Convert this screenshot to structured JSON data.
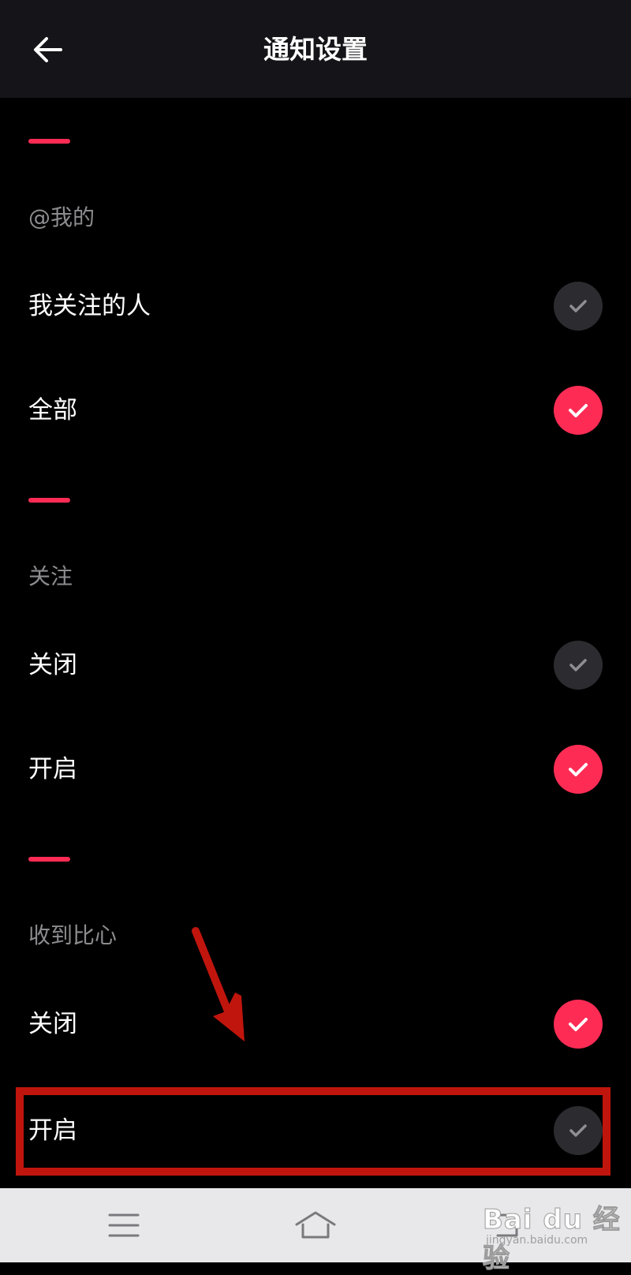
{
  "header": {
    "title": "通知设置"
  },
  "sections": [
    {
      "label": "@我的",
      "options": [
        {
          "label": "我关注的人",
          "checked": false
        },
        {
          "label": "全部",
          "checked": true
        }
      ]
    },
    {
      "label": "关注",
      "options": [
        {
          "label": "关闭",
          "checked": false
        },
        {
          "label": "开启",
          "checked": true
        }
      ]
    },
    {
      "label": "收到比心",
      "options": [
        {
          "label": "关闭",
          "checked": true
        },
        {
          "label": "开启",
          "checked": false
        }
      ]
    }
  ],
  "colors": {
    "accent": "#fe2c55",
    "unchecked": "#2c2c30",
    "header_bg": "#151418",
    "annotation": "#c0150d"
  },
  "navbar": {
    "icons": [
      "menu-icon",
      "home-icon",
      "back-nav-icon"
    ]
  },
  "watermark": {
    "main": "Bai du 经验",
    "sub": "jingyan.baidu.com"
  }
}
